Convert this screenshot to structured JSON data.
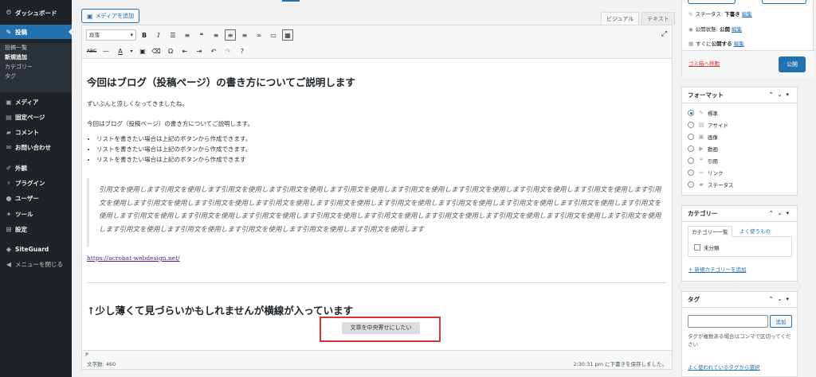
{
  "sidebar": {
    "items": [
      {
        "icon": "dashboard-icon",
        "glyph": "⏲",
        "label": "ダッシュボード"
      },
      {
        "icon": "pushpin-icon",
        "glyph": "✎",
        "label": "投稿"
      },
      {
        "icon": "media-icon",
        "glyph": "▣",
        "label": "メディア"
      },
      {
        "icon": "page-icon",
        "glyph": "▤",
        "label": "固定ページ"
      },
      {
        "icon": "comment-icon",
        "glyph": "▰",
        "label": "コメント"
      },
      {
        "icon": "mail-icon",
        "glyph": "✉",
        "label": "お問い合わせ"
      },
      {
        "icon": "appearance-icon",
        "glyph": "✐",
        "label": "外観"
      },
      {
        "icon": "plugin-icon",
        "glyph": "⚡",
        "label": "プラグイン"
      },
      {
        "icon": "user-icon",
        "glyph": "●",
        "label": "ユーザー"
      },
      {
        "icon": "tools-icon",
        "glyph": "✦",
        "label": "ツール"
      },
      {
        "icon": "settings-icon",
        "glyph": "⊞",
        "label": "設定"
      },
      {
        "icon": "siteguard-icon",
        "glyph": "◆",
        "label": "SiteGuard"
      },
      {
        "icon": "collapse-icon",
        "glyph": "◀",
        "label": "メニューを閉じる"
      }
    ],
    "submenu": [
      "投稿一覧",
      "新規追加",
      "カテゴリー",
      "タグ"
    ]
  },
  "editor": {
    "add_media": "メディアを追加",
    "tabs": {
      "visual": "ビジュアル",
      "text": "テキスト"
    },
    "format_select": "段落",
    "content": {
      "heading": "今回はブログ（投稿ページ）の書き方についてご説明します",
      "p1": "ずいぶんと涼しくなってきましたね。",
      "p2": "今回はブログ（投稿ページ）の書き方についてご説明します。",
      "list": [
        "リストを書きたい場合は上記のボタンから作成できます。",
        "リストを書きたい場合は上記のボタンから作成できます。",
        "リストを書きたい場合は上記のボタンから作成できます"
      ],
      "quote": "引用文を使用します引用文を使用します引用文を使用します引用文を使用します引用文を使用します引用文を使用します引用文を使用します引用文を使用します引用文を使用します引用文を使用します引用文を使用します引用文を使用します引用文を使用します引用文を使用します引用文を使用します引用文を使用します引用文を使用します引用文を使用します引用文を使用します引用文を使用します引用文を使用します引用文を使用します引用文を使用します引用文を使用します引用文を使用します引用文を使用します引用文を使用します引用文を使用します引用文を使用します引用文を使用します引用文を使用します引用文を使用します引用文を使用します",
      "link": "https://acrobat-webdesign.net/",
      "subheading": "↑少し薄くて見づらいかもしれませんが横線が入っています",
      "centered": "文章を中央寄せにしたい"
    },
    "path": "P",
    "word_count": "文字数: 460",
    "autosave": "2:30:31 pm に下書きを保存しました。"
  },
  "publish": {
    "status_label": "ステータス: ",
    "status_value": "下書き",
    "visibility_label": "公開状態: ",
    "visibility_value": "公開",
    "schedule_label": "すぐに",
    "schedule_suffix": "公開する",
    "edit": "編集",
    "trash": "ゴミ箱へ移動",
    "button": "公開"
  },
  "format_box": {
    "title": "フォーマット",
    "options": [
      {
        "label": "標準",
        "icon": "pin-icon",
        "glyph": "✎",
        "checked": true
      },
      {
        "label": "アサイド",
        "icon": "aside-icon",
        "glyph": "▤",
        "checked": false
      },
      {
        "label": "画像",
        "icon": "image-icon",
        "glyph": "▣",
        "checked": false
      },
      {
        "label": "動画",
        "icon": "video-icon",
        "glyph": "▶",
        "checked": false
      },
      {
        "label": "引用",
        "icon": "quote-icon",
        "glyph": "❝",
        "checked": false
      },
      {
        "label": "リンク",
        "icon": "link-icon",
        "glyph": "∞",
        "checked": false
      },
      {
        "label": "ステータス",
        "icon": "status-icon",
        "glyph": "▰",
        "checked": false
      }
    ]
  },
  "category_box": {
    "title": "カテゴリー",
    "tab_all": "カテゴリー一覧",
    "tab_popular": "よく使うもの",
    "item": "未分類",
    "new_link": "+ 新規カテゴリーを追加"
  },
  "tag_box": {
    "title": "タグ",
    "add": "追加",
    "help": "タグが複数ある場合はコンマで区切ってください",
    "popular_link": "よく使われているタグから選択"
  }
}
